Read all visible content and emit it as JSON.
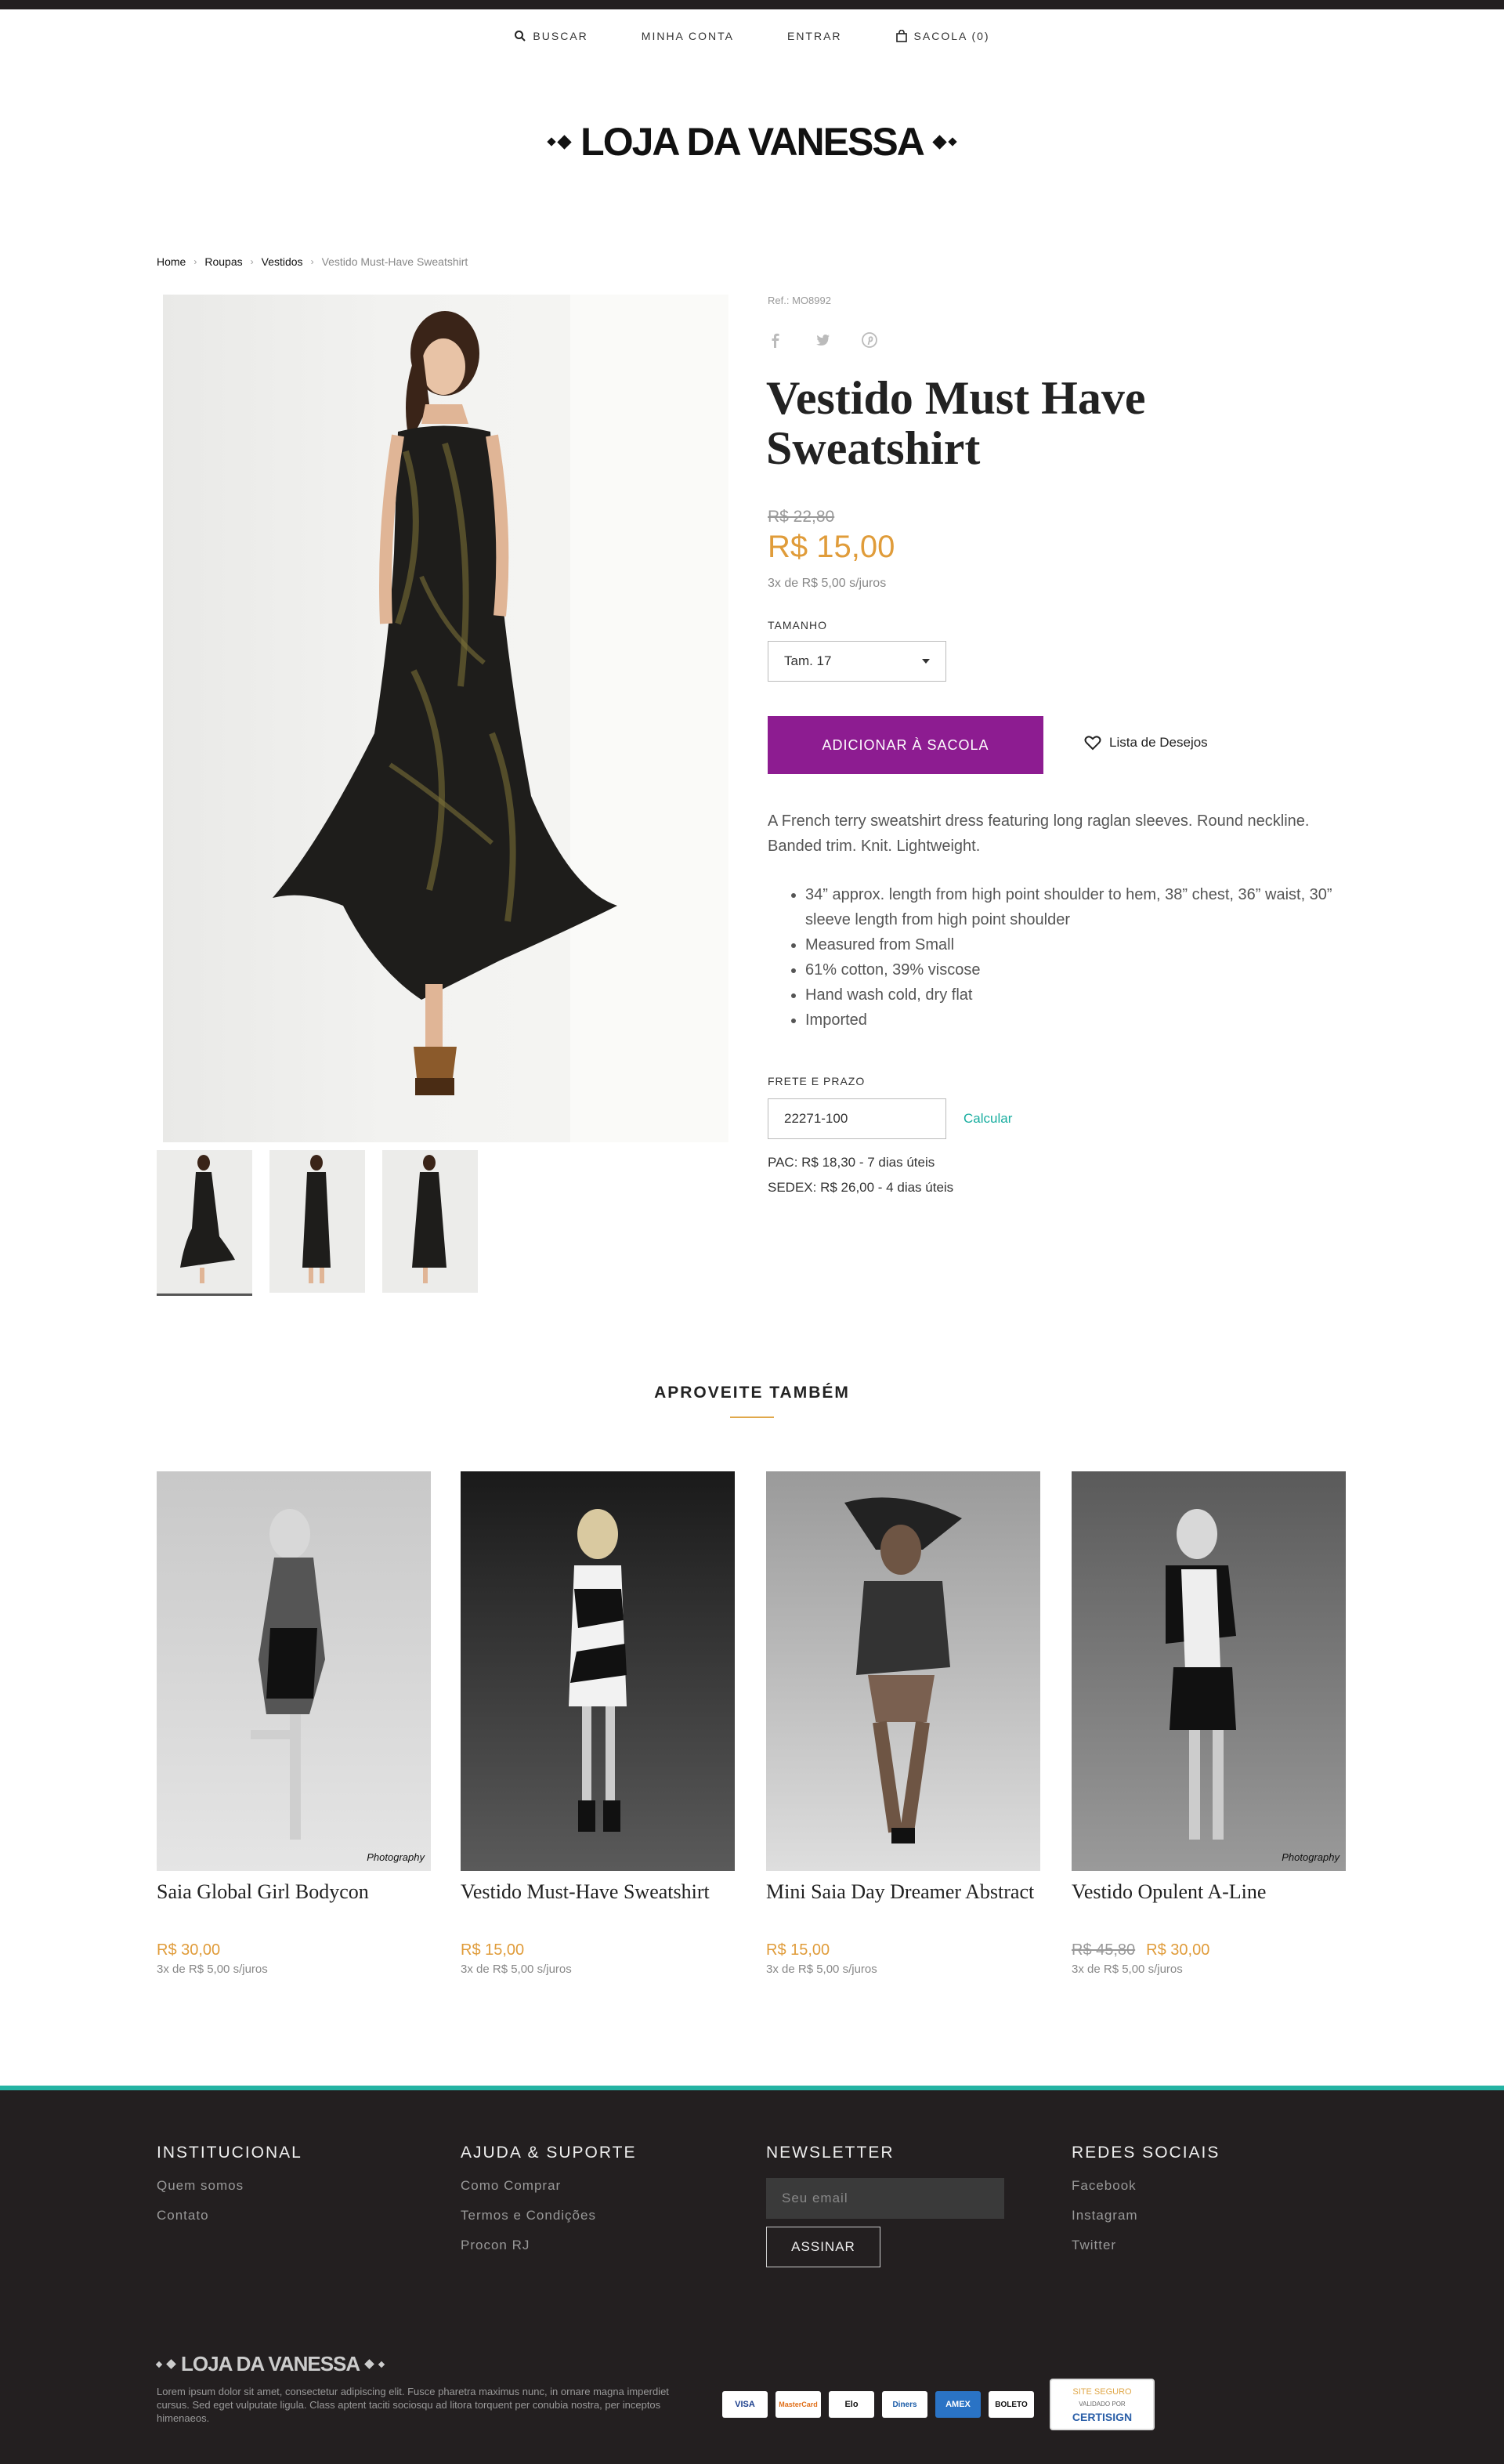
{
  "nav": {
    "search": "BUSCAR",
    "account": "MINHA CONTA",
    "login": "ENTRAR",
    "bag": "SACOLA (0)"
  },
  "logo": "LOJA DA VANESSA",
  "breadcrumb": [
    "Home",
    "Roupas",
    "Vestidos",
    "Vestido Must-Have Sweatshirt"
  ],
  "product": {
    "ref": "Ref.: MO8992",
    "title": "Vestido Must Have Sweatshirt",
    "old_price": "R$ 22,80",
    "price": "R$ 15,00",
    "installments": "3x de R$ 5,00 s/juros",
    "size_label": "TAMANHO",
    "size_value": "Tam. 17",
    "add_button": "ADICIONAR À SACOLA",
    "wishlist": "Lista de Desejos",
    "description": "A French terry sweatshirt dress featuring long raglan sleeves. Round neckline. Banded trim. Knit. Lightweight.",
    "features": [
      "34” approx. length from high point shoulder to hem, 38” chest, 36” waist, 30” sleeve length from high point shoulder",
      "Measured from Small",
      "61% cotton, 39% viscose",
      "Hand wash cold, dry flat",
      "Imported"
    ],
    "shipping_label": "FRETE E PRAZO",
    "cep": "22271-100",
    "calculate": "Calcular",
    "pac": "PAC: R$ 18,30 - 7 dias úteis",
    "sedex": "SEDEX: R$ 26,00 - 4 dias úteis"
  },
  "related": {
    "title": "APROVEITE TAMBÉM",
    "items": [
      {
        "name": "Saia Global Girl Bodycon",
        "old_price": "",
        "price": "R$ 30,00",
        "installments": "3x de R$ 5,00 s/juros"
      },
      {
        "name": "Vestido Must-Have Sweatshirt",
        "old_price": "",
        "price": "R$ 15,00",
        "installments": "3x de R$ 5,00 s/juros"
      },
      {
        "name": "Mini Saia Day Dreamer Abstract",
        "old_price": "",
        "price": "R$ 15,00",
        "installments": "3x de R$ 5,00 s/juros"
      },
      {
        "name": "Vestido Opulent A-Line",
        "old_price": "R$ 45,80",
        "price": "R$ 30,00",
        "installments": "3x de R$ 5,00 s/juros"
      }
    ],
    "watermark": "Photography"
  },
  "footer": {
    "institutional": {
      "title": "INSTITUCIONAL",
      "links": [
        "Quem somos",
        "Contato"
      ]
    },
    "help": {
      "title": "AJUDA & SUPORTE",
      "links": [
        "Como Comprar",
        "Termos e Condições",
        "Procon RJ"
      ]
    },
    "newsletter": {
      "title": "NEWSLETTER",
      "placeholder": "Seu email",
      "button": "ASSINAR"
    },
    "social": {
      "title": "REDES SOCIAIS",
      "links": [
        "Facebook",
        "Instagram",
        "Twitter"
      ]
    },
    "logo": "LOJA DA VANESSA",
    "lorem": "Lorem ipsum dolor sit amet, consectetur adipiscing elit. Fusce pharetra maximus nunc, in ornare magna imperdiet cursus. Sed eget vulputate ligula. Class aptent taciti sociosqu ad litora torquent per conubia nostra, per inceptos himenaeos.",
    "payments": [
      "VISA",
      "MasterCard",
      "Elo",
      "Diners",
      "AMEX",
      "BOLETO"
    ],
    "seal": [
      "SITE SEGURO",
      "VALIDADO POR",
      "CERTISIGN"
    ]
  },
  "colors": {
    "accent_purple": "#8d1c91",
    "price_orange": "#e09c3a",
    "teal": "#24b3a3",
    "footer_bg": "#231f20"
  }
}
